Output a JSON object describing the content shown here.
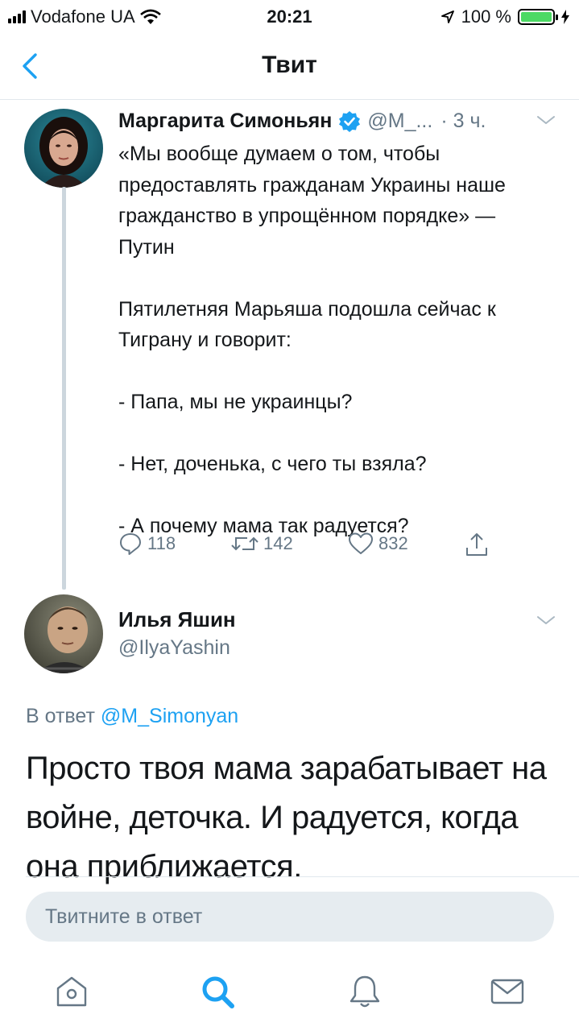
{
  "status_bar": {
    "carrier": "Vodafone UA",
    "time": "20:21",
    "battery": "100 %",
    "battery_level": 1.0
  },
  "nav": {
    "title": "Твит",
    "back_icon": "chevron-left-icon"
  },
  "tweet1": {
    "name": "Маргарита Симоньян",
    "handle": "@M_...",
    "time": "· 3 ч.",
    "verified": true,
    "text": "«Мы вообще думаем о том, чтобы предоставлять гражданам Украины наше гражданство в упрощённом порядке» — Путин\n\nПятилетняя Марьяша подошла сейчас к Тиграну и говорит:\n\n- Папа, мы не украинцы?\n\n- Нет, доченька, с чего ты взяла?\n\n- А почему мама так радуется?",
    "actions": {
      "replies": "118",
      "retweets": "142",
      "likes": "832"
    }
  },
  "tweet2": {
    "name": "Илья Яшин",
    "handle": "@IlyaYashin",
    "reply_prefix": "В ответ",
    "reply_to": "@M_Simonyan",
    "text": "Просто твоя мама зарабатывает на войне, деточка. И радуется, когда она приближается."
  },
  "reply_input": {
    "placeholder": "Твитните в ответ"
  },
  "tabbar": {
    "items": [
      "home-icon",
      "search-icon",
      "bell-icon",
      "mail-icon"
    ],
    "active": "search-icon"
  },
  "colors": {
    "accent": "#1da1f2",
    "secondary_text": "#657786",
    "battery_green": "#4cd964"
  }
}
